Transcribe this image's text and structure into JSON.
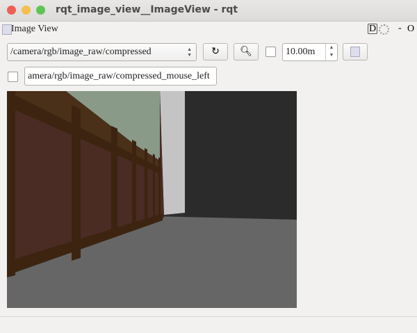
{
  "window": {
    "title": "rqt_image_view__ImageView - rqt"
  },
  "plugin": {
    "title": "Image View",
    "right_icons": "D",
    "minus": "-",
    "o": "O"
  },
  "toolbar": {
    "topic": "/camera/rgb/image_raw/compressed",
    "zoom_value": "10.00m",
    "mouse_topic": "amera/rgb/image_raw/compressed_mouse_left"
  },
  "colors": {
    "close": "#ed5f55",
    "minimize": "#f6be4f",
    "maximize": "#5fc454"
  }
}
